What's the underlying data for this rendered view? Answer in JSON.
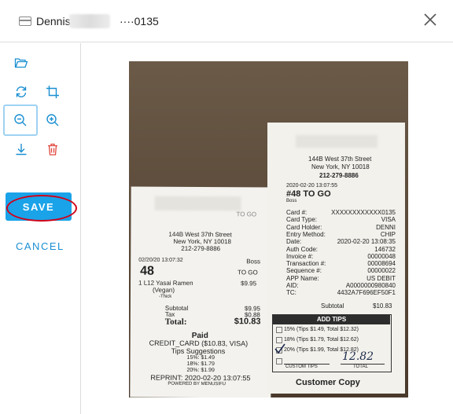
{
  "header": {
    "cardholder_name": "Dennis",
    "card_last4": "····0135",
    "icons": {
      "card": "card-icon",
      "close": "close-icon"
    }
  },
  "toolbar": {
    "icons": [
      "folder-open-icon",
      "rotate-icon",
      "crop-icon",
      "zoom-out-icon",
      "zoom-in-icon",
      "download-icon",
      "trash-icon"
    ],
    "save_label": "SAVE",
    "cancel_label": "CANCEL",
    "colors": {
      "accent": "#1aa3e8",
      "delete": "#e0483e",
      "highlight": "#d0021b"
    }
  },
  "receipt_left": {
    "to_go_top": "TO GO",
    "address1": "144B West 37th Street",
    "address2": "New York, NY 10018",
    "phone": "212-279-8886",
    "datetime": "02/20/20 13:07:32",
    "server": "Boss",
    "order_no": "48",
    "to_go": "TO GO",
    "item_line": "1    L12 Yasai Ramen",
    "item_price": "$9.95",
    "item_detail": "(Vegan)",
    "item_mod": "-Thick",
    "subtotal_label": "Subtotal",
    "subtotal": "$9.95",
    "tax_label": "Tax",
    "tax": "$0.88",
    "total_label": "Total:",
    "total": "$10.83",
    "paid": "Paid",
    "payment": "CREDIT_CARD ($10.83, VISA)",
    "tips_heading": "Tips Suggestions",
    "tips": [
      "15%: $1.49",
      "18%: $1.79",
      "20%: $1.99"
    ],
    "reprint": "REPRINT: 2020-02-20 13:07:55",
    "powered": "POWERED BY MENUSIFU"
  },
  "receipt_right": {
    "address1": "144B West 37th Street",
    "address2": "New York, NY 10018",
    "phone": "212-279-8886",
    "datetime": "2020-02-20 13:07:55",
    "order": "#48  TO GO",
    "server": "Boss",
    "fields": [
      {
        "label": "Card #:",
        "value": "XXXXXXXXXXXX0135"
      },
      {
        "label": "Card Type:",
        "value": "VISA"
      },
      {
        "label": "Card Holder:",
        "value": "DENNI"
      },
      {
        "label": "Entry Method:",
        "value": "CHIP"
      },
      {
        "label": "Date:",
        "value": "2020-02-20 13:08:35"
      },
      {
        "label": "Auth Code:",
        "value": "146732"
      },
      {
        "label": "Invoice #:",
        "value": "00000048"
      },
      {
        "label": "Transaction #:",
        "value": "00008694"
      },
      {
        "label": "Sequence #:",
        "value": "00000022"
      },
      {
        "label": "APP Name:",
        "value": "US DEBIT"
      },
      {
        "label": "AID:",
        "value": "A0000000980840"
      },
      {
        "label": "TC:",
        "value": "4432A7F696EF50F1"
      }
    ],
    "subtotal_label": "Subtotal",
    "subtotal": "$10.83",
    "add_tips": "ADD TIPS",
    "tip_options": [
      "15% (Tips $1.49, Total $12.32)",
      "18% (Tips $1.79, Total $12.62)",
      "20% (Tips $1.99, Total $12.82)"
    ],
    "handwritten_total": "12.82",
    "custom_tips": "CUSTOM TIPS",
    "total_label": "TOTAL",
    "customer_copy": "Customer Copy"
  }
}
